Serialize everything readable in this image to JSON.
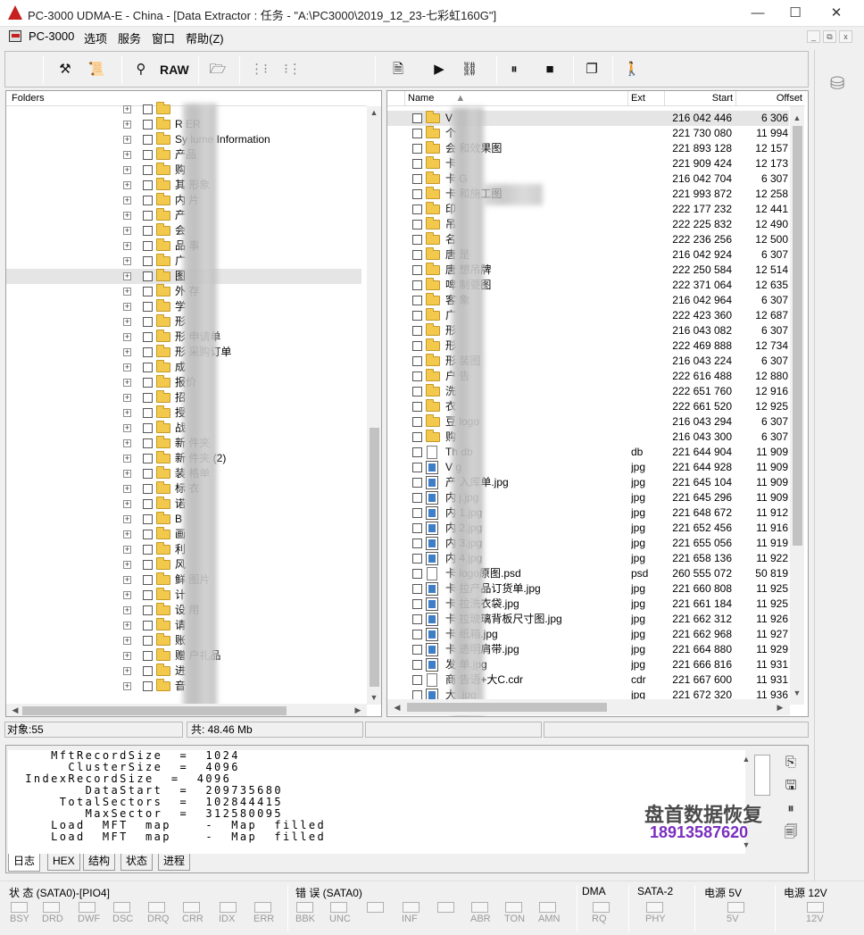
{
  "title": "PC-3000 UDMA-E - China - [Data Extractor : 任务 - \"A:\\PC3000\\2019_12_23-七彩虹160G\"]",
  "menu": [
    "PC-3000",
    "选项",
    "服务",
    "窗口",
    "帮助(Z)"
  ],
  "window_buttons": [
    "—",
    "☐",
    "✕"
  ],
  "mdi_buttons": [
    "_",
    "⧉",
    "x"
  ],
  "toolbar": {
    "raw": "RAW"
  },
  "folders": {
    "header": "Folders",
    "items": [
      "",
      "R ER",
      "Sy lume Information",
      "产品",
      "购",
      "其 形象",
      "内 片",
      "产",
      "会",
      "品 事",
      "广",
      "图",
      "外 存",
      "学",
      "形",
      "形 申请单",
      "形 采购订单",
      "成",
      "报价",
      "招",
      "授",
      "战",
      "新 件夹",
      "新 件夹 (2)",
      "装 格单",
      "标 衣",
      "诺",
      "B",
      "画",
      "利",
      "风",
      "鲜 图片",
      "计",
      "设 用",
      "请",
      "账",
      "赠 户礼品",
      "进",
      "音"
    ]
  },
  "files": {
    "columns": [
      "Name",
      "Ext",
      "Start",
      "Offset"
    ],
    "rows": [
      {
        "name": "V",
        "ext": "",
        "start": "216 042 446",
        "offset": "6 306",
        "type": "folder"
      },
      {
        "name": "个",
        "ext": "",
        "start": "221 730 080",
        "offset": "11 994",
        "type": "folder"
      },
      {
        "name": "会 和效果图",
        "ext": "",
        "start": "221 893 128",
        "offset": "12 157",
        "type": "folder"
      },
      {
        "name": "卡",
        "ext": "",
        "start": "221 909 424",
        "offset": "12 173",
        "type": "folder"
      },
      {
        "name": "卡 G",
        "ext": "",
        "start": "216 042 704",
        "offset": "6 307",
        "type": "folder"
      },
      {
        "name": "卡 和施工图",
        "ext": "",
        "start": "221 993 872",
        "offset": "12 258",
        "type": "folder"
      },
      {
        "name": "印",
        "ext": "",
        "start": "222 177 232",
        "offset": "12 441",
        "type": "folder"
      },
      {
        "name": "吊",
        "ext": "",
        "start": "222 225 832",
        "offset": "12 490",
        "type": "folder"
      },
      {
        "name": "名",
        "ext": "",
        "start": "222 236 256",
        "offset": "12 500",
        "type": "folder"
      },
      {
        "name": "唐 是",
        "ext": "",
        "start": "216 042 924",
        "offset": "6 307",
        "type": "folder"
      },
      {
        "name": "唐 想吊牌",
        "ext": "",
        "start": "222 250 584",
        "offset": "12 514",
        "type": "folder"
      },
      {
        "name": "啤 制要图",
        "ext": "",
        "start": "222 371 064",
        "offset": "12 635",
        "type": "folder"
      },
      {
        "name": "客 象",
        "ext": "",
        "start": "216 042 964",
        "offset": "6 307",
        "type": "folder"
      },
      {
        "name": "广",
        "ext": "",
        "start": "222 423 360",
        "offset": "12 687",
        "type": "folder"
      },
      {
        "name": "形",
        "ext": "",
        "start": "216 043 082",
        "offset": "6 307",
        "type": "folder"
      },
      {
        "name": "形",
        "ext": "",
        "start": "222 469 888",
        "offset": "12 734",
        "type": "folder"
      },
      {
        "name": "形 装图",
        "ext": "",
        "start": "216 043 224",
        "offset": "6 307",
        "type": "folder"
      },
      {
        "name": "户 告",
        "ext": "",
        "start": "222 616 488",
        "offset": "12 880",
        "type": "folder"
      },
      {
        "name": "洗",
        "ext": "",
        "start": "222 651 760",
        "offset": "12 916",
        "type": "folder"
      },
      {
        "name": "衣",
        "ext": "",
        "start": "222 661 520",
        "offset": "12 925",
        "type": "folder"
      },
      {
        "name": "豆 logo",
        "ext": "",
        "start": "216 043 294",
        "offset": "6 307",
        "type": "folder"
      },
      {
        "name": "购",
        "ext": "",
        "start": "216 043 300",
        "offset": "6 307",
        "type": "folder"
      },
      {
        "name": "Th db",
        "ext": "db",
        "start": "221 644 904",
        "offset": "11 909",
        "type": "doc"
      },
      {
        "name": "V g",
        "ext": "jpg",
        "start": "221 644 928",
        "offset": "11 909",
        "type": "jpg"
      },
      {
        "name": "产 入库单.jpg",
        "ext": "jpg",
        "start": "221 645 104",
        "offset": "11 909",
        "type": "jpg"
      },
      {
        "name": "内 j.jpg",
        "ext": "jpg",
        "start": "221 645 296",
        "offset": "11 909",
        "type": "jpg"
      },
      {
        "name": "内 1.jpg",
        "ext": "jpg",
        "start": "221 648 672",
        "offset": "11 912",
        "type": "jpg"
      },
      {
        "name": "内 2.jpg",
        "ext": "jpg",
        "start": "221 652 456",
        "offset": "11 916",
        "type": "jpg"
      },
      {
        "name": "内 3.jpg",
        "ext": "jpg",
        "start": "221 655 056",
        "offset": "11 919",
        "type": "jpg"
      },
      {
        "name": "内 4.jpg",
        "ext": "jpg",
        "start": "221 658 136",
        "offset": "11 922",
        "type": "jpg"
      },
      {
        "name": "卡 logo原图.psd",
        "ext": "psd",
        "start": "260 555 072",
        "offset": "50 819",
        "type": "doc"
      },
      {
        "name": "卡 拉产品订货单.jpg",
        "ext": "jpg",
        "start": "221 660 808",
        "offset": "11 925",
        "type": "jpg"
      },
      {
        "name": "卡 拉洗衣袋.jpg",
        "ext": "jpg",
        "start": "221 661 184",
        "offset": "11 925",
        "type": "jpg"
      },
      {
        "name": "卡 拉玻璃背板尺寸图.jpg",
        "ext": "jpg",
        "start": "221 662 312",
        "offset": "11 926",
        "type": "jpg"
      },
      {
        "name": "卡 纸箱.jpg",
        "ext": "jpg",
        "start": "221 662 968",
        "offset": "11 927",
        "type": "jpg"
      },
      {
        "name": "卡 透明肩带.jpg",
        "ext": "jpg",
        "start": "221 664 880",
        "offset": "11 929",
        "type": "jpg"
      },
      {
        "name": "发 单.jpg",
        "ext": "jpg",
        "start": "221 666 816",
        "offset": "11 931",
        "type": "jpg"
      },
      {
        "name": "商 告语+大C.cdr",
        "ext": "cdr",
        "start": "221 667 600",
        "offset": "11 931",
        "type": "doc"
      },
      {
        "name": "大 .jpg",
        "ext": "jpg",
        "start": "221 672 320",
        "offset": "11 936",
        "type": "jpg"
      }
    ]
  },
  "status": {
    "objects": "对象:55",
    "total": "共: 48.46 Mb"
  },
  "log": [
    "     MftRecordSize  =  1024",
    "       ClusterSize  =  4096",
    "  IndexRecordSize  =  4096",
    "         DataStart  =  209735680",
    "      TotalSectors  =  102844415",
    "         MaxSector  =  312580095",
    "     Load  MFT  map    -  Map  filled",
    "     Load  MFT  map    -  Map  filled"
  ],
  "tabs": [
    "日志",
    "HEX",
    "结构",
    "状态",
    "进程"
  ],
  "watermark": {
    "line1": "盘首数据恢复",
    "line2": "18913587620"
  },
  "bottom": {
    "groups": [
      {
        "title": "状 态 (SATA0)-[PIO4]",
        "leds": [
          "BSY",
          "DRD",
          "DWF",
          "DSC",
          "DRQ",
          "CRR",
          "IDX",
          "ERR"
        ]
      },
      {
        "title": "错 误 (SATA0)",
        "leds": [
          "BBK",
          "UNC",
          "",
          "INF",
          "",
          "ABR",
          "TON",
          "AMN"
        ]
      },
      {
        "title": "DMA",
        "leds": [
          "RQ"
        ]
      },
      {
        "title": "SATA-2",
        "leds": [
          "PHY"
        ]
      },
      {
        "title": "电源 5V",
        "leds": [
          "5V"
        ]
      },
      {
        "title": "电源 12V",
        "leds": [
          "12V"
        ]
      }
    ]
  }
}
